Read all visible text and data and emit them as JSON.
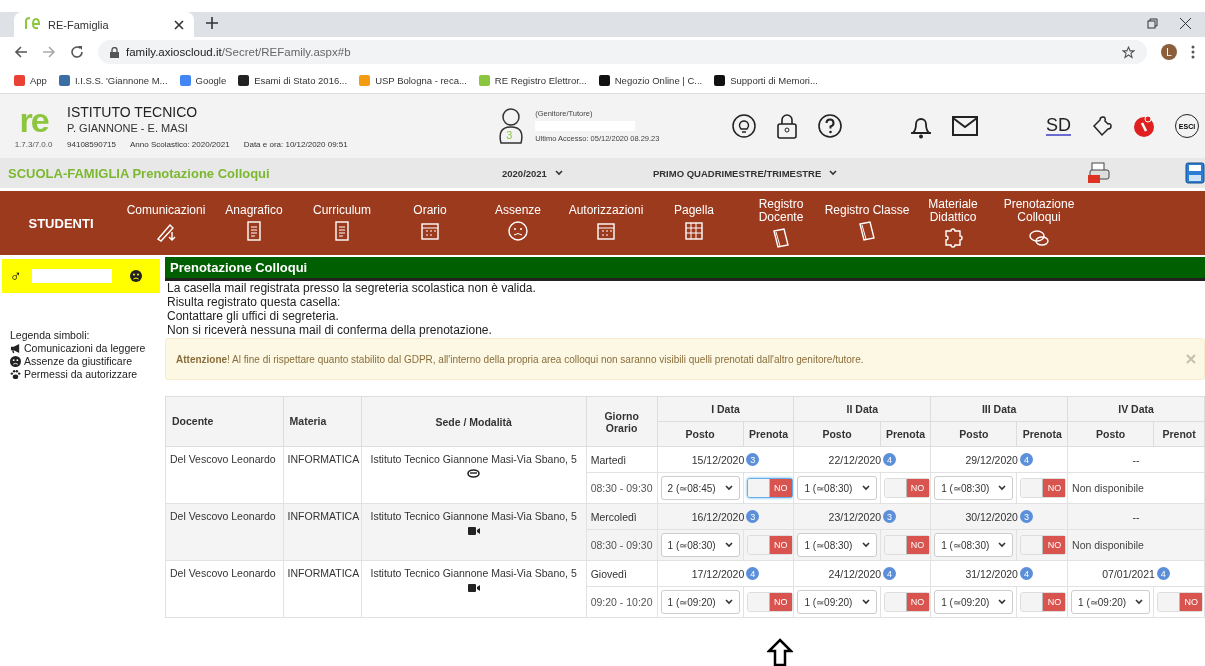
{
  "browser": {
    "tab_title": "RE-Famiglia",
    "url_host": "family.axioscloud.it",
    "url_path": "/Secret/REFamily.aspx#b",
    "profile_initial": "L",
    "bookmarks": [
      {
        "label": "App",
        "color": "#e94235"
      },
      {
        "label": "I.I.S.S. 'Giannone M...",
        "color": "#3b6ea5"
      },
      {
        "label": "Google",
        "color": "#4285f4"
      },
      {
        "label": "Esami di Stato 2016...",
        "color": "#222222"
      },
      {
        "label": "USP Bologna - reca...",
        "color": "#f39c12"
      },
      {
        "label": "RE Registro Elettror...",
        "color": "#8cc63f"
      },
      {
        "label": "Negozio Online | C...",
        "color": "#111111"
      },
      {
        "label": "Supporti di Memori...",
        "color": "#111111"
      }
    ]
  },
  "header": {
    "logo": "re",
    "version": "1.7.3/7.0.0",
    "school_line1": "ISTITUTO TECNICO",
    "school_line2": "P. GIANNONE - E. MASI",
    "code": "94108590715",
    "school_year": "Anno Scolastico: 2020/2021",
    "datetime": "Data e ora: 10/12/2020 09:51",
    "user_badge": "3",
    "role": "(Genitore/Tutore)",
    "last_access": "Ultimo Accesso: 05/12/2020 08.29.23",
    "sd_logo": "SD",
    "exit_label": "ESCI"
  },
  "subbar": {
    "title": "SCUOLA-FAMIGLIA Prenotazione Colloqui",
    "year": "2020/2021",
    "period": "PRIMO QUADRIMESTRE/TRIMESTRE"
  },
  "menu": {
    "section": "STUDENTI",
    "items": [
      {
        "label": "Comunicazioni",
        "selected": false
      },
      {
        "label": "Anagrafico",
        "selected": false
      },
      {
        "label": "Curriculum",
        "selected": false
      },
      {
        "label": "Orario",
        "selected": false
      },
      {
        "label": "Assenze",
        "selected": false
      },
      {
        "label": "Autorizzazioni",
        "selected": false
      },
      {
        "label": "Pagella",
        "selected": false
      },
      {
        "label": "Registro Docente",
        "selected": false
      },
      {
        "label": "Registro Classe",
        "selected": false
      },
      {
        "label": "Materiale Didattico",
        "selected": false
      },
      {
        "label": "Prenotazione Colloqui",
        "selected": false
      }
    ]
  },
  "student": {
    "gender_symbol": "♂"
  },
  "legend": {
    "title": "Legenda simboli:",
    "items": [
      "Comunicazioni da leggere",
      "Assenze da giustificare",
      "Permessi da autorizzare"
    ]
  },
  "panel": {
    "title": "Prenotazione Colloqui",
    "messages": [
      "La casella mail registrata presso la segreteria scolastica non è valida.",
      "Risulta registrato questa casella:",
      "Contattare gli uffici di segreteria.",
      "Non si riceverà nessuna mail di conferma della prenotazione."
    ],
    "alert": "**Attenzione**! Al fine di rispettare quanto stabilito dal GDPR, all'interno della propria area colloqui non saranno visibili quelli prenotati dall'altro genitore/tutore."
  },
  "table": {
    "columns": [
      "Docente",
      "Materia",
      "Sede / Modalità",
      "Giorno Orario"
    ],
    "date_groups": [
      {
        "label": "I Data",
        "posto": "Posto",
        "prenota": "Prenota"
      },
      {
        "label": "II Data",
        "posto": "Posto",
        "prenota": "Prenota"
      },
      {
        "label": "III Data",
        "posto": "Posto",
        "prenota": "Prenota"
      },
      {
        "label": "IV Data",
        "posto": "Posto",
        "prenota": "Prenot"
      }
    ],
    "rows": [
      {
        "docente": "Del Vescovo Leonardo",
        "materia": "INFORMATICA",
        "sede": "Istituto Tecnico Giannone Masi-Via Sbano, 5",
        "kind": "in_person",
        "day": "Martedì",
        "time": "08:30 - 09:30",
        "slots": [
          {
            "kind": "open",
            "date": "15/12/2020",
            "count": "3",
            "posto": "2 (≃08:45)",
            "toggle": "NO",
            "on": false,
            "focused": true
          },
          {
            "kind": "open",
            "date": "22/12/2020",
            "count": "4",
            "posto": "1 (≃08:30)",
            "toggle": "NO",
            "on": false
          },
          {
            "kind": "open",
            "date": "29/12/2020",
            "count": "4",
            "posto": "1 (≃08:30)",
            "toggle": "NO",
            "on": false
          },
          {
            "kind": "unavailable",
            "date": "--",
            "note": "Non disponibile"
          }
        ]
      },
      {
        "docente": "Del Vescovo Leonardo",
        "materia": "INFORMATICA",
        "sede": "Istituto Tecnico Giannone Masi-Via Sbano, 5",
        "kind": "video",
        "day": "Mercoledì",
        "time": "08:30 - 09:30",
        "slots": [
          {
            "kind": "open",
            "date": "16/12/2020",
            "count": "3",
            "posto": "1 (≃08:30)",
            "toggle": "NO",
            "on": false
          },
          {
            "kind": "open",
            "date": "23/12/2020",
            "count": "3",
            "posto": "1 (≃08:30)",
            "toggle": "NO",
            "on": false
          },
          {
            "kind": "open",
            "date": "30/12/2020",
            "count": "3",
            "posto": "1 (≃08:30)",
            "toggle": "NO",
            "on": false
          },
          {
            "kind": "unavailable",
            "date": "--",
            "note": "Non disponibile"
          }
        ]
      },
      {
        "docente": "Del Vescovo Leonardo",
        "materia": "INFORMATICA",
        "sede": "Istituto Tecnico Giannone Masi-Via Sbano, 5",
        "kind": "video",
        "day": "Giovedì",
        "time": "09:20 - 10:20",
        "slots": [
          {
            "kind": "open",
            "date": "17/12/2020",
            "count": "4",
            "posto": "1 (≃09:20)",
            "toggle": "NO",
            "on": false
          },
          {
            "kind": "open",
            "date": "24/12/2020",
            "count": "4",
            "posto": "1 (≃09:20)",
            "toggle": "NO",
            "on": false
          },
          {
            "kind": "open",
            "date": "31/12/2020",
            "count": "4",
            "posto": "1 (≃09:20)",
            "toggle": "NO",
            "on": false
          },
          {
            "kind": "open",
            "date": "07/01/2021",
            "count": "4",
            "posto": "1 (≃09:20)",
            "toggle": "NO",
            "on": false
          }
        ]
      }
    ]
  }
}
